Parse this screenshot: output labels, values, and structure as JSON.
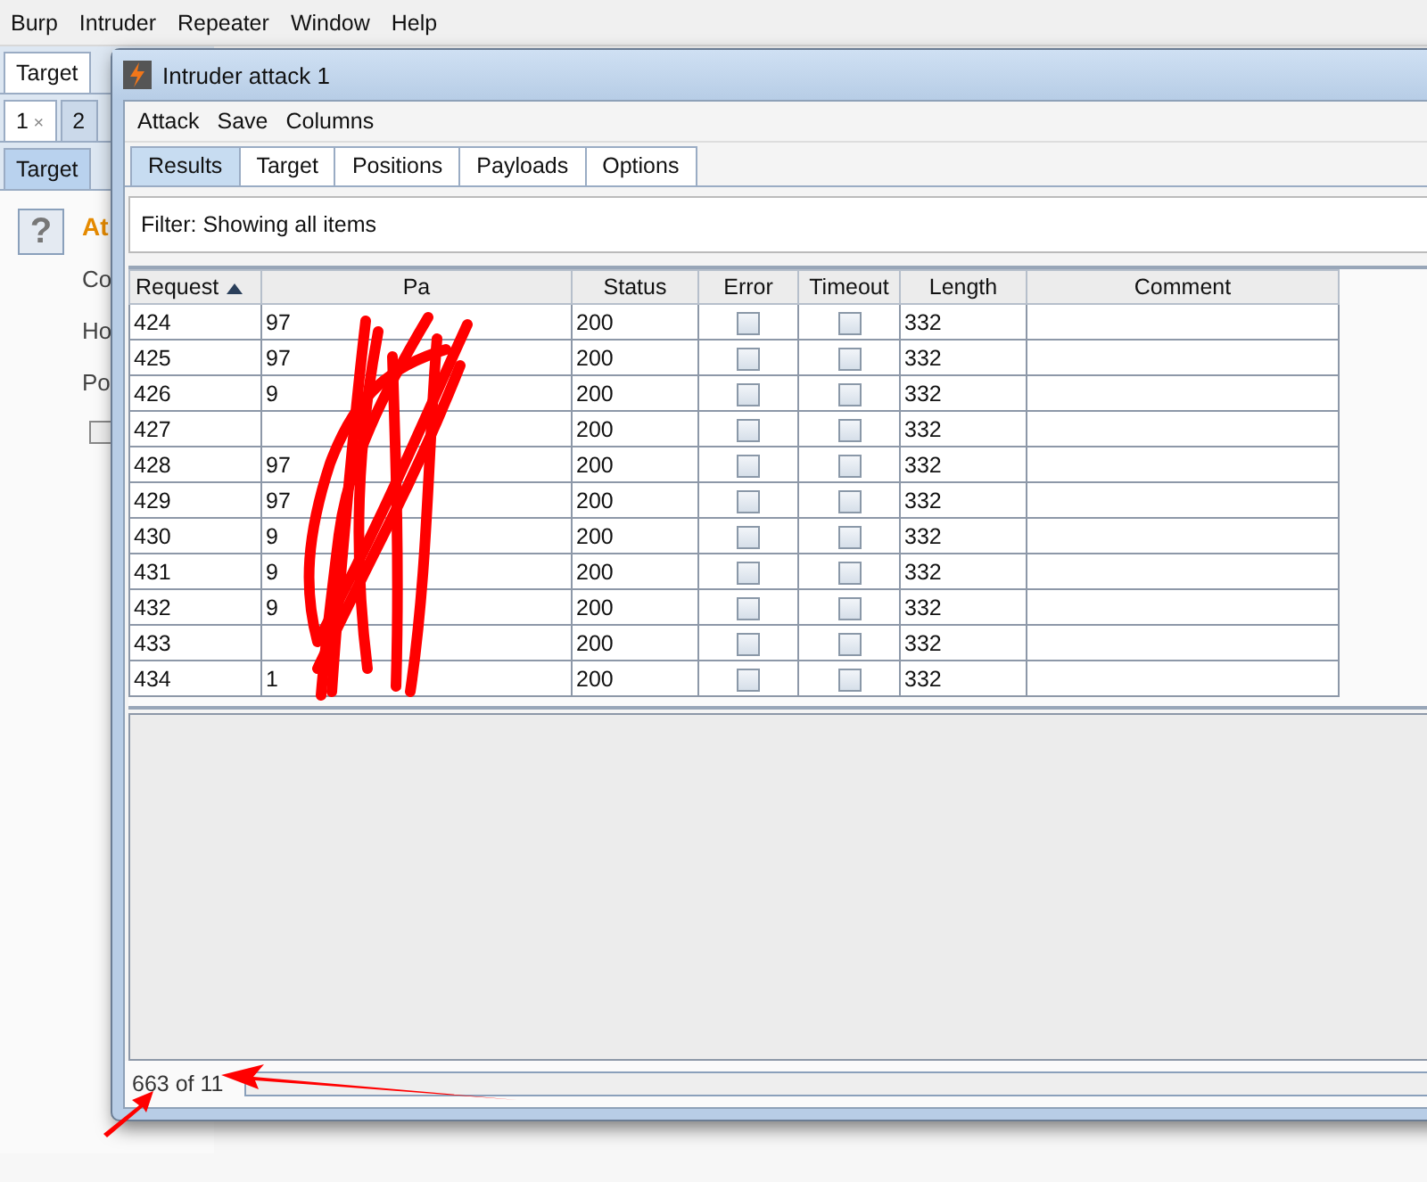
{
  "main_menu": [
    "Burp",
    "Intruder",
    "Repeater",
    "Window",
    "Help"
  ],
  "main_tabs": [
    {
      "label": "Target",
      "selected": true
    }
  ],
  "request_tabs": [
    {
      "label": "1",
      "close": "×",
      "selected": true
    },
    {
      "label": "2",
      "selected": false
    }
  ],
  "sub_tabs": [
    {
      "label": "Target",
      "selected": true
    }
  ],
  "background_panel": {
    "help": "?",
    "heading": "At",
    "lines": [
      "Co",
      "Ho",
      "Po"
    ],
    "checked": false
  },
  "window": {
    "title": "Intruder attack 1",
    "menu": [
      "Attack",
      "Save",
      "Columns"
    ],
    "tabs": [
      {
        "label": "Results",
        "selected": true
      },
      {
        "label": "Target",
        "selected": false
      },
      {
        "label": "Positions",
        "selected": false
      },
      {
        "label": "Payloads",
        "selected": false
      },
      {
        "label": "Options",
        "selected": false
      }
    ],
    "filter": "Filter: Showing all items",
    "table": {
      "columns": [
        {
          "label": "Request",
          "sorted": true
        },
        {
          "label": "Pa",
          "sorted": false
        },
        {
          "label": "Status",
          "sorted": false
        },
        {
          "label": "Error",
          "sorted": false
        },
        {
          "label": "Timeout",
          "sorted": false
        },
        {
          "label": "Length",
          "sorted": false
        },
        {
          "label": "Comment",
          "sorted": false
        }
      ],
      "rows": [
        {
          "request": "424",
          "payload": "97",
          "status": "200",
          "error": false,
          "timeout": false,
          "length": "332"
        },
        {
          "request": "425",
          "payload": "97",
          "status": "200",
          "error": false,
          "timeout": false,
          "length": "332"
        },
        {
          "request": "426",
          "payload": "9",
          "status": "200",
          "error": false,
          "timeout": false,
          "length": "332"
        },
        {
          "request": "427",
          "status": "200",
          "error": false,
          "timeout": false,
          "length": "332"
        },
        {
          "request": "428",
          "payload": "97",
          "status": "200",
          "error": false,
          "timeout": false,
          "length": "332"
        },
        {
          "request": "429",
          "payload": "97",
          "status": "200",
          "error": false,
          "timeout": false,
          "length": "332"
        },
        {
          "request": "430",
          "payload": "9",
          "status": "200",
          "error": false,
          "timeout": false,
          "length": "332"
        },
        {
          "request": "431",
          "payload": "9",
          "status": "200",
          "error": false,
          "timeout": false,
          "length": "332"
        },
        {
          "request": "432",
          "payload": "9",
          "status": "200",
          "error": false,
          "timeout": false,
          "length": "332"
        },
        {
          "request": "433",
          "status": "200",
          "error": false,
          "timeout": false,
          "length": "332"
        },
        {
          "request": "434",
          "payload": "1",
          "status": "200",
          "error": false,
          "timeout": false,
          "length": "332"
        }
      ]
    },
    "status": "663 of 11",
    "progress": {
      "level": 0
    }
  }
}
